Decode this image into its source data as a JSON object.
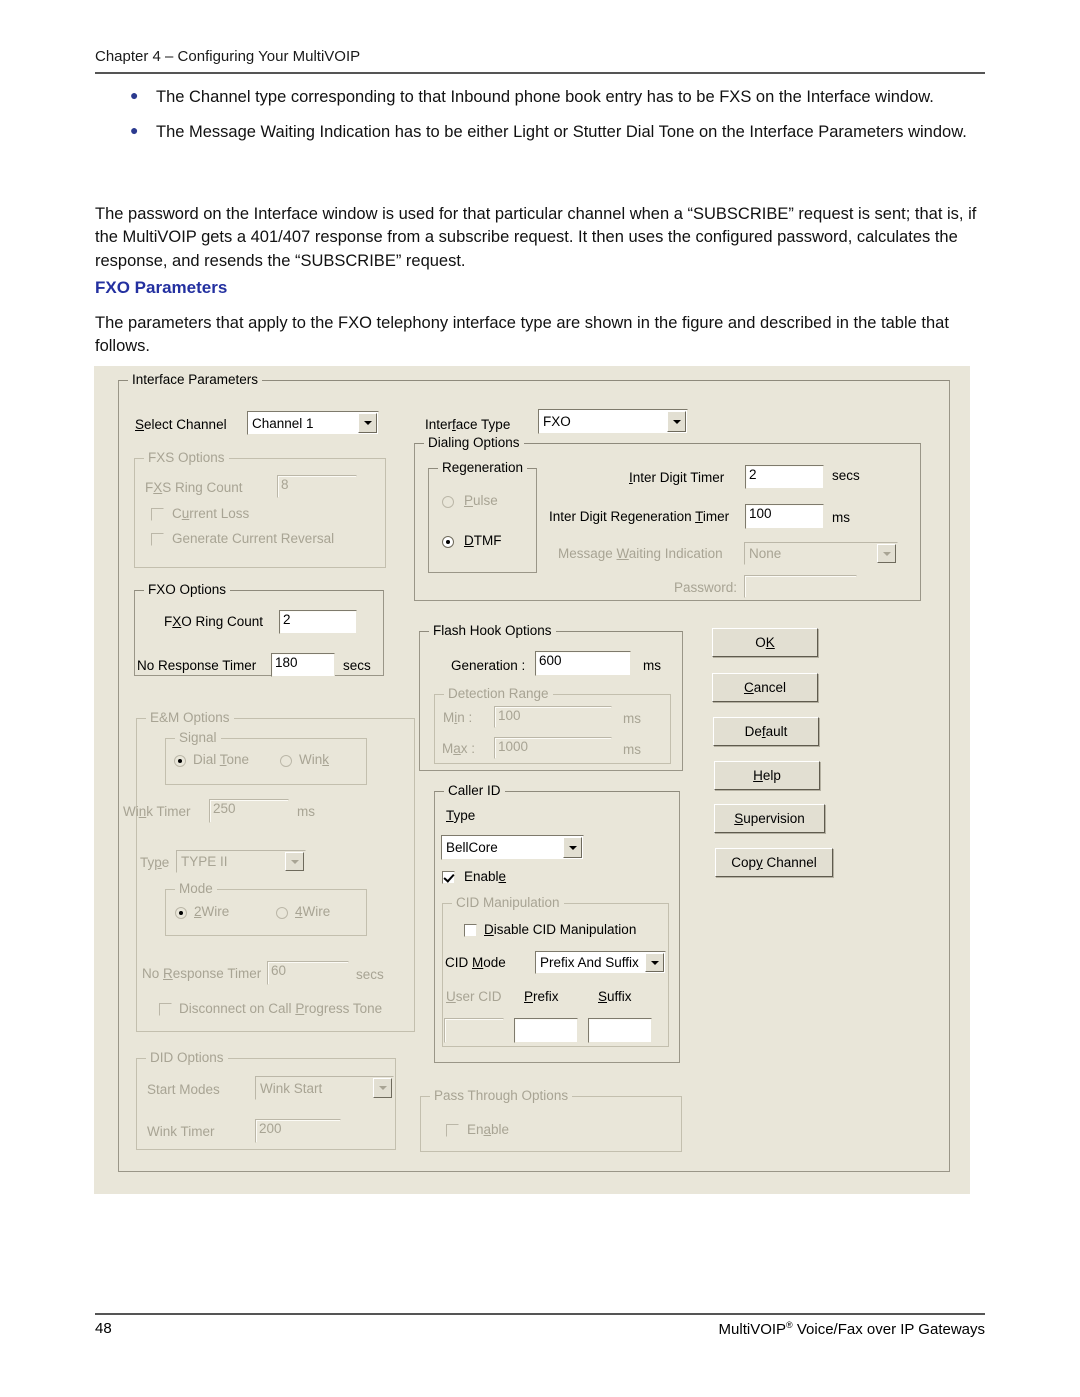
{
  "page": {
    "header": "Chapter 4 – Configuring Your MultiVOIP",
    "footer_page_number": "48",
    "footer_right": "MultiVOIP",
    "footer_right_sup": "®",
    "footer_right_tail": " Voice/Fax over IP Gateways"
  },
  "prose": {
    "bullets": [
      "The Channel type corresponding to that Inbound phone book entry has to be FXS on the Interface window.",
      "The Message Waiting Indication has to be either Light or Stutter Dial Tone on the Interface Parameters window."
    ],
    "bullet_glyph": "●",
    "paragraph_1": "The password on the Interface window is used for that particular channel when a “SUBSCRIBE” request is sent; that is, if the MultiVOIP gets a 401/407 response from a subscribe request. It then uses the configured password, calculates the response, and resends the “SUBSCRIBE” request.",
    "section_title": "FXO Parameters",
    "paragraph_2": "The parameters that apply to the FXO telephony interface type are shown in the figure and described in the table that follows."
  },
  "dialog": {
    "group_caption": "Interface Parameters",
    "select_channel": {
      "label_prefix": "S",
      "label_rest": "elect Channel",
      "value": "Channel 1"
    },
    "interface_type": {
      "label_a": "Inter",
      "label_u": "f",
      "label_b": "ace Type",
      "value": "FXO"
    },
    "fxs_options": {
      "caption": "FXS Options",
      "ring_count_label_a": "F",
      "ring_count_label_u": "X",
      "ring_count_label_b": "S Ring Count",
      "ring_count_value": "8",
      "current_loss_label_a": "C",
      "current_loss_label_u": "u",
      "current_loss_label_b": "rrent  Loss",
      "generate_reversal_label": "Generate Current Reversal"
    },
    "fxo_options": {
      "caption": "FXO Options",
      "ring_count_label_a": "F",
      "ring_count_label_u": "X",
      "ring_count_label_b": "O Ring Count",
      "ring_count_value": "2",
      "no_response_label": "No Response Timer",
      "no_response_value": "180",
      "no_response_units": "secs"
    },
    "dialing_options": {
      "caption": "Dialing Options",
      "regeneration_caption": "Regeneration",
      "pulse_label_a": "",
      "pulse_label_u": "P",
      "pulse_label_b": "ulse",
      "dtmf_label_u": "D",
      "dtmf_label_b": "TMF",
      "inter_digit_timer_label_u": "I",
      "inter_digit_timer_label_b": "nter Digit Timer",
      "inter_digit_timer_value": "2",
      "inter_digit_timer_units": "secs",
      "regen_timer_label_a": "Inter Digit Regeneration ",
      "regen_timer_label_u": "T",
      "regen_timer_label_b": "imer",
      "regen_timer_value": "100",
      "regen_timer_units": "ms",
      "mwi_label_a": "Message ",
      "mwi_label_u": "W",
      "mwi_label_b": "aiting Indication",
      "mwi_value": "None",
      "password_label": "Password:",
      "password_value": ""
    },
    "em_options": {
      "caption": "E&M Options",
      "signal_caption": "Signal",
      "dial_tone_label_a": "Dial ",
      "dial_tone_label_u": "T",
      "dial_tone_label_b": "one",
      "wink_label_a": "Win",
      "wink_label_u": "k",
      "wink_label_b": "",
      "wink_timer_label_a": "Wi",
      "wink_timer_label_u": "n",
      "wink_timer_label_b": "k Timer",
      "wink_timer_value": "250",
      "wink_timer_units": "ms",
      "type_label_a": "Ty",
      "type_label_u": "p",
      "type_label_b": "e",
      "type_value": "TYPE II",
      "mode_caption": "Mode",
      "two_wire_label_u": "2",
      "two_wire_label_b": "Wire",
      "four_wire_label_u": "4",
      "four_wire_label_b": "Wire",
      "no_response_label_a": "No ",
      "no_response_label_u": "R",
      "no_response_label_b": "esponse Timer",
      "no_response_value": "60",
      "no_response_units": "secs",
      "disconnect_label_a": "Disconnect on Call ",
      "disconnect_label_u": "P",
      "disconnect_label_b": "rogress Tone"
    },
    "flash_hook_options": {
      "caption": "Flash Hook Options",
      "generation_label_a": "Generation",
      "generation_label_u": "",
      "generation_label_b": " :",
      "generation_value": "600",
      "generation_units": "ms",
      "detection_range_caption": "Detection Range",
      "min_label_a": "M",
      "min_label_u": "i",
      "min_label_b": "n :",
      "min_value": "100",
      "min_units": "ms",
      "max_label_a": "M",
      "max_label_u": "a",
      "max_label_b": "x :",
      "max_value": "1000",
      "max_units": "ms"
    },
    "caller_id": {
      "caption": "Caller ID",
      "type_label_u": "T",
      "type_label_b": "ype",
      "type_value": "BellCore",
      "enable_label_a": "Enabl",
      "enable_label_u": "e",
      "cid_manipulation_caption": "CID Manipulation",
      "disable_cid_label_u": "D",
      "disable_cid_label_b": "isable CID Manipulation",
      "cid_mode_label_a": "CID ",
      "cid_mode_label_u": "M",
      "cid_mode_label_b": "ode",
      "cid_mode_value": "Prefix And Suffix",
      "user_cid_label_u": "U",
      "user_cid_label_b": "ser CID",
      "prefix_label_u": "P",
      "prefix_label_b": "refix",
      "suffix_label_u": "S",
      "suffix_label_b": "uffix",
      "user_cid_value": "",
      "prefix_value": "",
      "suffix_value": ""
    },
    "did_options": {
      "caption": "DID Options",
      "start_modes_label": "Start Modes",
      "start_modes_value": "Wink Start",
      "wink_timer_label": "Wink Timer",
      "wink_timer_value": "200"
    },
    "pass_through_options": {
      "caption": "Pass Through Options",
      "enable_label_a": "En",
      "enable_label_u": "a",
      "enable_label_b": "ble"
    },
    "buttons": {
      "ok_a": "OK",
      "ok_u": "K",
      "cancel_u": "C",
      "cancel_b": "ancel",
      "default_a": "De",
      "default_u": "f",
      "default_b": "ault",
      "help_u": "H",
      "help_b": "elp",
      "supervision_u": "S",
      "supervision_b": "upervision",
      "copy_channel_a": "Cop",
      "copy_channel_u": "y",
      "copy_channel_b": " Channel"
    }
  },
  "colors": {
    "dialog_bg": "#E9E6D9",
    "heading": "#2330A0",
    "bullet": "#2B3A8F",
    "disabled_text": "#A8A494"
  }
}
